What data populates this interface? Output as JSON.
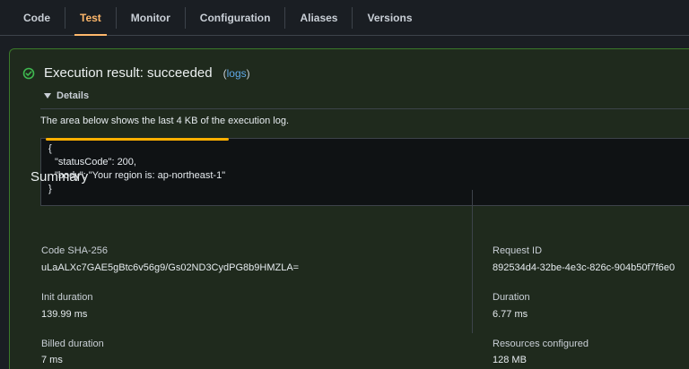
{
  "tabs": [
    {
      "label": "Code",
      "active": false
    },
    {
      "label": "Test",
      "active": true
    },
    {
      "label": "Monitor",
      "active": false
    },
    {
      "label": "Configuration",
      "active": false
    },
    {
      "label": "Aliases",
      "active": false
    },
    {
      "label": "Versions",
      "active": false
    }
  ],
  "colors": {
    "accent": "#ffb86b",
    "success": "#3fb950",
    "highlight": "#ffb000"
  },
  "result": {
    "title": "Execution result: succeeded",
    "logs_link": "logs",
    "details_label": "Details",
    "description": "The area below shows the last 4 KB of the execution log.",
    "log_lines": [
      "{",
      "\"statusCode\": 200,",
      "\"body\": \"Your region is: ap-northeast-1\"",
      "}"
    ]
  },
  "summary": {
    "title": "Summary",
    "code_sha_label": "Code SHA-256",
    "code_sha_value": "uLaALXc7GAE5gBtc6v56g9/Gs02ND3CydPG8b9HMZLA=",
    "request_id_label": "Request ID",
    "request_id_value": "892534d4-32be-4e3c-826c-904b50f7f6e0",
    "init_duration_label": "Init duration",
    "init_duration_value": "139.99 ms",
    "duration_label": "Duration",
    "duration_value": "6.77 ms",
    "billed_duration_label": "Billed duration",
    "billed_duration_value": "7 ms",
    "resources_label": "Resources configured",
    "resources_value": "128 MB"
  }
}
